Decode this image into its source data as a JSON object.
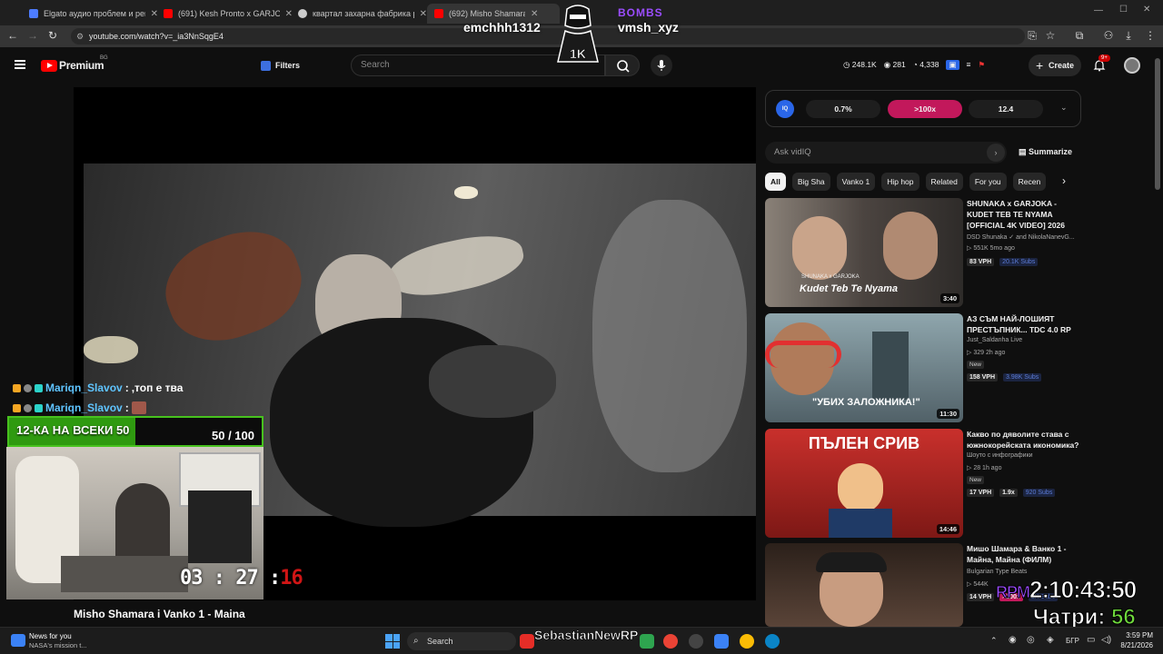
{
  "browser": {
    "tabs": [
      {
        "label": "Elgato аудио проблем и реш...",
        "color": "#4d7cff"
      },
      {
        "label": "(691) Kesh Pronto x GARJOKA",
        "color": "#ff0000"
      },
      {
        "label": "квартал захарна фабрика рус...",
        "color": "#cccccc"
      },
      {
        "label": "(692) Misho Shamara",
        "color": "#ff0000"
      }
    ],
    "url": "youtube.com/watch?v=_ia3NnSqgE4"
  },
  "youtube": {
    "logo": "Premium",
    "logo_sup": "BG",
    "filters_label": "Filters",
    "search_placeholder": "Search",
    "stats": [
      "248.1K",
      "281",
      "4,338"
    ],
    "create_label": "Create",
    "notif_badge": "9+"
  },
  "stream_overlay": {
    "user_left": "emchhh1312",
    "user_right": "vmsh_xyz",
    "bombs_label": "BOMBS",
    "mascot_label": "1K",
    "chat": [
      {
        "name": "Mariqn_Slavov",
        "sep": ":",
        "message": ",топ е тва"
      },
      {
        "name": "Mariqn_Slavov",
        "sep": ":",
        "message": ""
      }
    ],
    "goal_label": "12-КА НА ВСЕКИ 50",
    "goal_count": "50 / 100",
    "goal_progress": 0.5,
    "cam_timer": "03 : 27 :",
    "cam_timer_red": "16",
    "big_timer_prefix": "RPM",
    "big_timer": "2:10:43:50",
    "chatri_label": "Чатри:",
    "chatri_value": "56",
    "streamer_name": "SebastianNewRP"
  },
  "video": {
    "title": "Misho Shamara i Vanko 1 - Maina"
  },
  "vidiq": {
    "logo": "IQ",
    "pills": [
      "0.7%",
      ">100x",
      "12.4"
    ],
    "ask_placeholder": "Ask vidIQ",
    "summarize": "Summarize"
  },
  "chips": [
    "All",
    "Big Sha",
    "Vanko 1",
    "Hip hop",
    "Related",
    "For you",
    "Recen"
  ],
  "recommendations": [
    {
      "title": "SHUNAKA x GARJOKA - KUDET TEB TE NYAMA [OFFICIAL 4K VIDEO] 2026",
      "channel": "DSD Shunaka ✓ and NikolaNanevG...",
      "meta": "▷ 551K   5mo ago",
      "tag": "",
      "vph": "83 VPH",
      "x": "",
      "subs": "20.1K Subs",
      "duration": "3:40",
      "thumb_text": "Kudet Teb Te Nyama",
      "thumb_sub": "SHUNAKA x GARJOKA",
      "thumb_color": "#5a5148"
    },
    {
      "title": "АЗ СЪМ НАЙ-ЛОШИЯТ ПРЕСТЪПНИК... TDC 4.0 RP",
      "channel": "Just_Saldanha Live",
      "meta": "▷ 329   2h ago",
      "tag": "New",
      "vph": "158 VPH",
      "x": "",
      "subs": "3.98K Subs",
      "duration": "11:30",
      "thumb_text": "\"УБИХ ЗАЛОЖНИКА!\"",
      "thumb_sub": "",
      "thumb_color": "#6c7f86"
    },
    {
      "title": "Какво по дяволите става с южнокорейската икономика?",
      "channel": "Шоуто с инфографики",
      "meta": "▷ 28   1h ago",
      "tag": "New",
      "vph": "17 VPH",
      "x": "1.9x",
      "subs": "920 Subs",
      "duration": "14:46",
      "thumb_text": "ПЪЛЕН СРИВ",
      "thumb_sub": "",
      "thumb_color": "#c0392b"
    },
    {
      "title": "Мишо Шамара & Ванко 1 - Майна, Майна (ФИЛМ)",
      "channel": "Bulgarian Type Beats",
      "meta": "▷ 544K",
      "tag": "",
      "vph": "14 VPH",
      "x": ">100x",
      "subs": "1K Subs",
      "duration": "",
      "thumb_text": "",
      "thumb_sub": "",
      "thumb_color": "#3a2a22"
    }
  ],
  "taskbar": {
    "news_title": "News for you",
    "news_sub": "NASA's mission t...",
    "search": "Search",
    "lang": "БГР",
    "time": "3:59 PM",
    "date": "8/21/2026"
  },
  "colors": {
    "yt_red": "#ff0000",
    "vidiq_active": "#c2185b",
    "goal_green": "#47c21e"
  }
}
